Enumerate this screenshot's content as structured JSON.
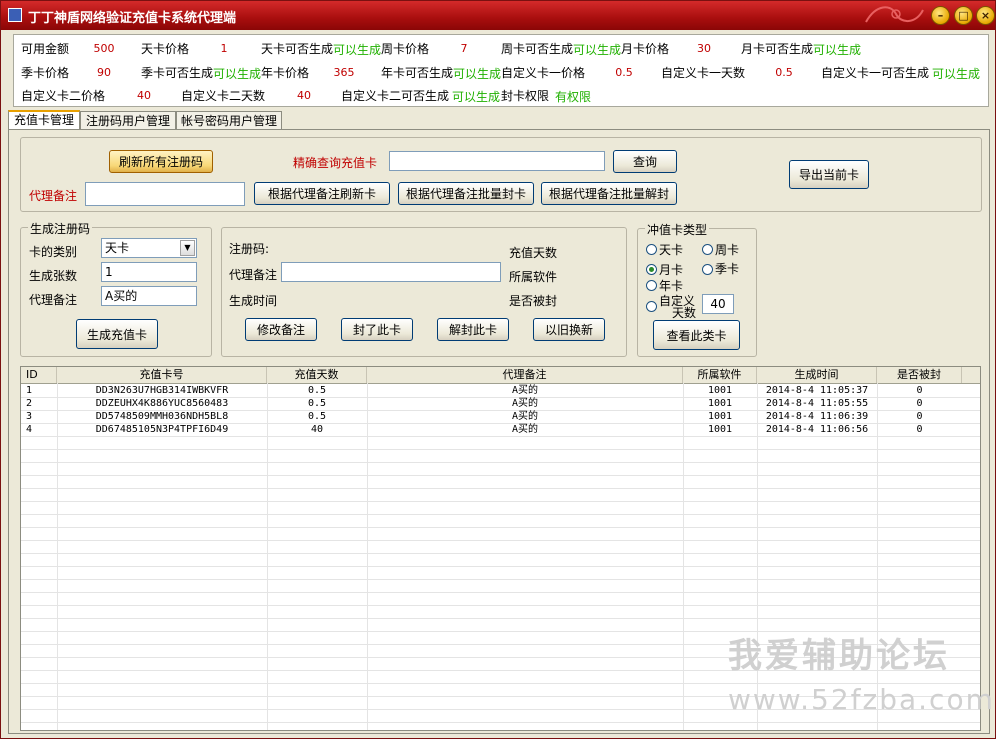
{
  "window": {
    "title": "丁丁神盾网络验证充值卡系统代理端"
  },
  "info": {
    "balance_label": "可用金额",
    "balance": "500",
    "day_price_label": "天卡价格",
    "day_price": "1",
    "day_gen_label": "天卡可否生成",
    "day_gen": "可以生成",
    "week_price_label": "周卡价格",
    "week_price": "7",
    "week_gen_label": "周卡可否生成",
    "week_gen": "可以生成",
    "month_price_label": "月卡价格",
    "month_price": "30",
    "month_gen_label": "月卡可否生成",
    "month_gen": "可以生成",
    "season_price_label": "季卡价格",
    "season_price": "90",
    "season_gen_label": "季卡可否生成",
    "season_gen": "可以生成",
    "year_price_label": "年卡价格",
    "year_price": "365",
    "year_gen_label": "年卡可否生成",
    "year_gen": "可以生成",
    "custom1_price_label": "自定义卡一价格",
    "custom1_price": "0.5",
    "custom1_days_label": "自定义卡一天数",
    "custom1_days": "0.5",
    "custom1_gen_label": "自定义卡一可否生成",
    "custom1_gen": "可以生成",
    "custom2_price_label": "自定义卡二价格",
    "custom2_price": "40",
    "custom2_days_label": "自定义卡二天数",
    "custom2_days": "40",
    "custom2_gen_label": "自定义卡二可否生成",
    "custom2_gen": "可以生成",
    "ban_perm_label": "封卡权限",
    "ban_perm": "有权限"
  },
  "tabs": [
    "充值卡管理",
    "注册码用户管理",
    "帐号密码用户管理"
  ],
  "top": {
    "refresh_all": "刷新所有注册码",
    "exact_query_label": "精确查询充值卡",
    "exact_query_value": "",
    "query": "查询",
    "export": "导出当前卡",
    "agent_note_label": "代理备注",
    "agent_note_value": "",
    "refresh_by_note": "根据代理备注刷新卡",
    "ban_by_note": "根据代理备注批量封卡",
    "unban_by_note": "根据代理备注批量解封"
  },
  "generate": {
    "title": "生成注册码",
    "type_label": "卡的类别",
    "type_value": "天卡",
    "count_label": "生成张数",
    "count_value": "1",
    "note_label": "代理备注",
    "note_value": "A买的",
    "gen_button": "生成充值卡"
  },
  "detail": {
    "code_label": "注册码:",
    "note_label": "代理备注",
    "note_value": "",
    "time_label": "生成时间",
    "days_label": "充值天数",
    "software_label": "所属软件",
    "banned_label": "是否被封",
    "edit_note": "修改备注",
    "ban_card": "封了此卡",
    "unban_card": "解封此卡",
    "renew": "以旧换新"
  },
  "cardtype": {
    "title": "冲值卡类型",
    "day": "天卡",
    "week": "周卡",
    "month": "月卡",
    "season": "季卡",
    "year": "年卡",
    "custom_l1": "自定义",
    "custom_l2": "天数",
    "custom_days": "40",
    "view_button": "查看此类卡"
  },
  "table": {
    "headers": [
      "ID",
      "充值卡号",
      "充值天数",
      "代理备注",
      "所属软件",
      "生成时间",
      "是否被封"
    ],
    "rows": [
      [
        "1",
        "DD3N263U7HGB314IWBKVFR",
        "0.5",
        "A买的",
        "1001",
        "2014-8-4 11:05:37",
        "0"
      ],
      [
        "2",
        "DDZEUHX4K886YUC8560483",
        "0.5",
        "A买的",
        "1001",
        "2014-8-4 11:05:55",
        "0"
      ],
      [
        "3",
        "DD5748509MMH036NDH5BL8",
        "0.5",
        "A买的",
        "1001",
        "2014-8-4 11:06:39",
        "0"
      ],
      [
        "4",
        "DD67485105N3P4TPFI6D49",
        "40",
        "A买的",
        "1001",
        "2014-8-4 11:06:56",
        "0"
      ]
    ]
  },
  "watermark": {
    "line1": "我爱辅助论坛",
    "line2": "www.52fzba.com"
  }
}
